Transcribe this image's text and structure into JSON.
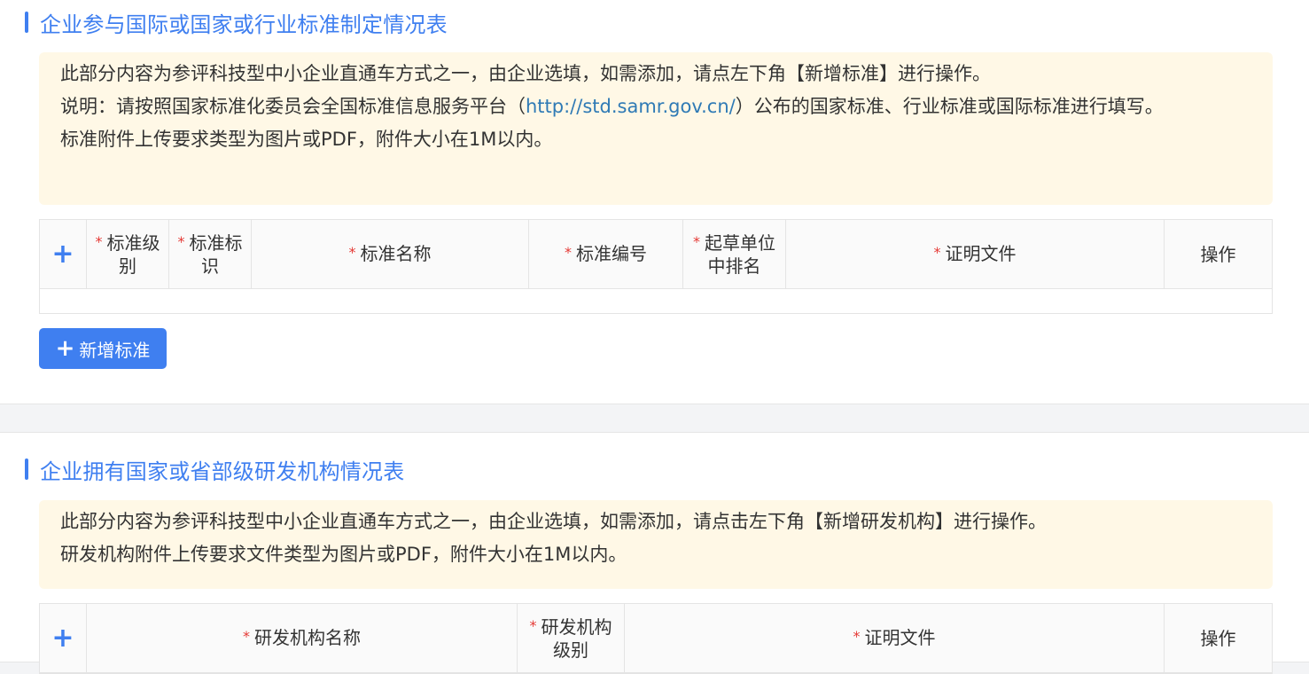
{
  "standards_section": {
    "title": "企业参与国际或国家或行业标准制定情况表",
    "notice": {
      "line1": "此部分内容为参评科技型中小企业直通车方式之一，由企业选填，如需添加，请点左下角【新增标准】进行操作。",
      "line2_prefix": "说明：请按照国家标准化委员会全国标准信息服务平台（",
      "line2_link": "http://std.samr.gov.cn/",
      "line2_suffix": "）公布的国家标准、行业标准或国际标准进行填写。",
      "line3": "标准附件上传要求类型为图片或PDF，附件大小在1M以内。"
    },
    "table": {
      "add_symbol": "+",
      "required_mark": "*",
      "columns": [
        "标准级别",
        "标准标识",
        "标准名称",
        "标准编号",
        "起草单位中排名",
        "证明文件"
      ],
      "action_column": "操作"
    },
    "add_button": {
      "icon": "+",
      "label": "新增标准"
    }
  },
  "rd_section": {
    "title": "企业拥有国家或省部级研发机构情况表",
    "notice": {
      "line1": "此部分内容为参评科技型中小企业直通车方式之一，由企业选填，如需添加，请点击左下角【新增研发机构】进行操作。",
      "line2": "研发机构附件上传要求文件类型为图片或PDF，附件大小在1M以内。"
    },
    "table": {
      "add_symbol": "+",
      "required_mark": "*",
      "columns": [
        "研发机构名称",
        "研发机构级别",
        "证明文件"
      ],
      "action_column": "操作"
    }
  },
  "colors": {
    "accent": "#3f7ff0",
    "notice_bg": "#fff8e6",
    "required": "#e53935",
    "link": "#2f7ab5"
  }
}
